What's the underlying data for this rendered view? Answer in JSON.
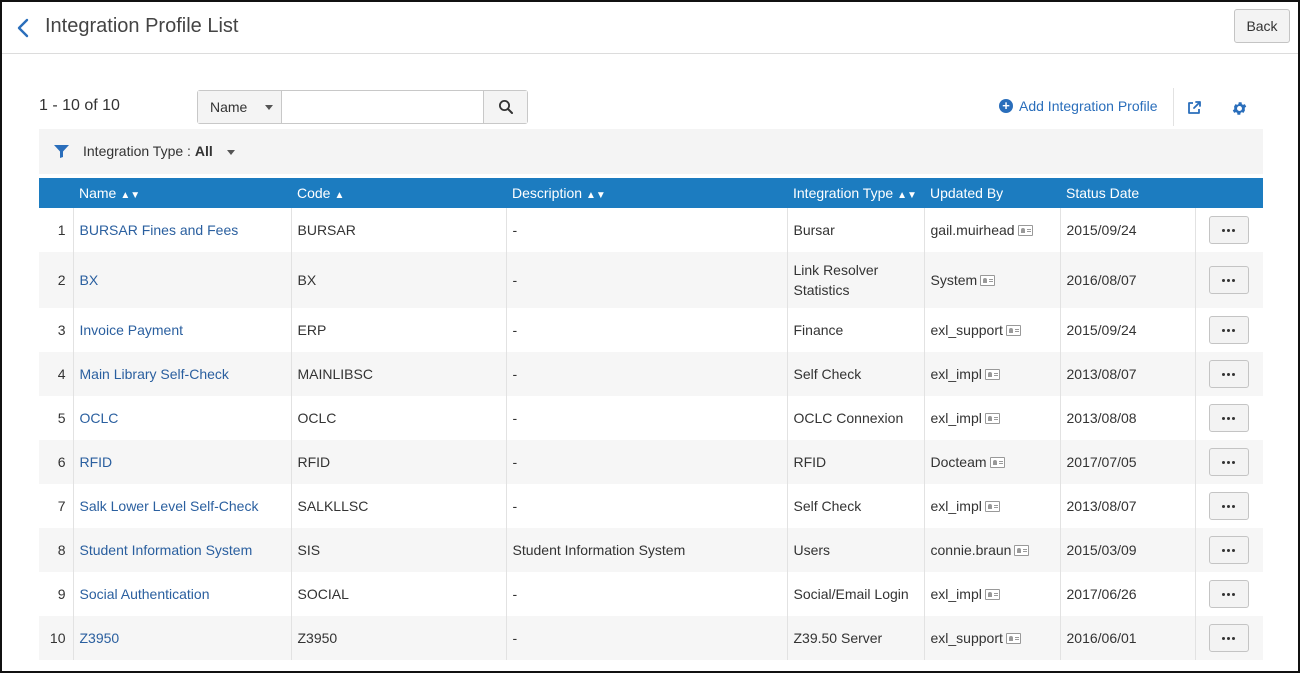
{
  "header": {
    "title": "Integration Profile List",
    "back_label": "Back"
  },
  "toolbar": {
    "count": "1 - 10 of 10",
    "search_field": "Name",
    "search_placeholder": "",
    "add_label": "Add Integration Profile"
  },
  "filter": {
    "label": "Integration Type :",
    "value": "All"
  },
  "table": {
    "columns": {
      "name": "Name",
      "code": "Code",
      "description": "Description",
      "type": "Integration Type",
      "updated_by": "Updated By",
      "status_date": "Status Date"
    },
    "rows": [
      {
        "num": "1",
        "name": "BURSAR Fines and Fees",
        "code": "BURSAR",
        "description": "-",
        "type": "Bursar",
        "updated_by": "gail.muirhead",
        "status_date": "2015/09/24"
      },
      {
        "num": "2",
        "name": "BX",
        "code": "BX",
        "description": "-",
        "type": "Link Resolver Statistics",
        "updated_by": "System",
        "status_date": "2016/08/07"
      },
      {
        "num": "3",
        "name": "Invoice Payment",
        "code": "ERP",
        "description": "-",
        "type": "Finance",
        "updated_by": "exl_support",
        "status_date": "2015/09/24"
      },
      {
        "num": "4",
        "name": "Main Library Self-Check",
        "code": "MAINLIBSC",
        "description": "-",
        "type": "Self Check",
        "updated_by": "exl_impl",
        "status_date": "2013/08/07"
      },
      {
        "num": "5",
        "name": "OCLC",
        "code": "OCLC",
        "description": "-",
        "type": "OCLC Connexion",
        "updated_by": "exl_impl",
        "status_date": "2013/08/08"
      },
      {
        "num": "6",
        "name": "RFID",
        "code": "RFID",
        "description": "-",
        "type": "RFID",
        "updated_by": "Docteam",
        "status_date": "2017/07/05"
      },
      {
        "num": "7",
        "name": "Salk Lower Level Self-Check",
        "code": "SALKLLSC",
        "description": "-",
        "type": "Self Check",
        "updated_by": "exl_impl",
        "status_date": "2013/08/07"
      },
      {
        "num": "8",
        "name": "Student Information System",
        "code": "SIS",
        "description": "Student Information System",
        "type": "Users",
        "updated_by": "connie.braun",
        "status_date": "2015/03/09"
      },
      {
        "num": "9",
        "name": "Social Authentication",
        "code": "SOCIAL",
        "description": "-",
        "type": "Social/Email Login",
        "updated_by": "exl_impl",
        "status_date": "2017/06/26"
      },
      {
        "num": "10",
        "name": "Z3950",
        "code": "Z3950",
        "description": "-",
        "type": "Z39.50 Server",
        "updated_by": "exl_support",
        "status_date": "2016/06/01"
      }
    ]
  },
  "colors": {
    "header_blue": "#1c7cc0",
    "link_blue": "#2a5f9f",
    "accent_blue": "#2a6ebb"
  }
}
